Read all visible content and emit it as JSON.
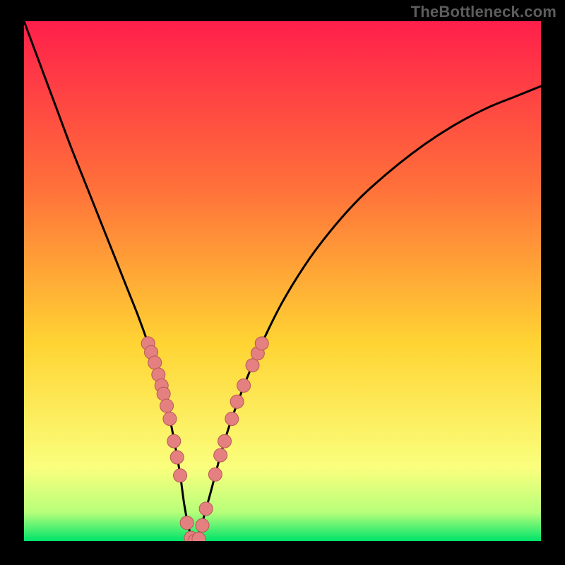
{
  "attribution": "TheBottleneck.com",
  "colors": {
    "gradient_top": "#ff1f4b",
    "gradient_mid_upper": "#ff703a",
    "gradient_mid": "#ffd433",
    "gradient_lower": "#faff7d",
    "gradient_lower2": "#b7ff7a",
    "gradient_bottom": "#00e46a",
    "curve": "#000000",
    "dot_fill": "#e48080",
    "dot_stroke": "#b85656",
    "frame": "#000000"
  },
  "chart_data": {
    "type": "line",
    "title": "",
    "xlabel": "",
    "ylabel": "",
    "xlim": [
      0,
      100
    ],
    "ylim": [
      0,
      100
    ],
    "x": [
      0,
      3,
      6,
      9,
      12,
      15,
      18,
      20,
      22,
      24,
      26,
      28,
      30,
      31,
      32,
      33,
      34,
      36,
      38,
      40,
      43,
      46,
      50,
      55,
      60,
      65,
      70,
      75,
      80,
      85,
      90,
      95,
      100
    ],
    "values": [
      100,
      92,
      84,
      76,
      68.5,
      61,
      53.5,
      48.5,
      43.5,
      38,
      32,
      24.5,
      14,
      7,
      2,
      0,
      2,
      9,
      16.5,
      23,
      31,
      38,
      46,
      54,
      60.5,
      66,
      70.5,
      74.5,
      78,
      81,
      83.5,
      85.5,
      87.5
    ],
    "minimum_x": 33,
    "dots": [
      {
        "x": 24.0,
        "y": 38.0
      },
      {
        "x": 24.6,
        "y": 36.3
      },
      {
        "x": 25.3,
        "y": 34.3
      },
      {
        "x": 26.0,
        "y": 32.0
      },
      {
        "x": 26.6,
        "y": 29.9
      },
      {
        "x": 27.0,
        "y": 28.3
      },
      {
        "x": 27.6,
        "y": 26.0
      },
      {
        "x": 28.2,
        "y": 23.5
      },
      {
        "x": 29.0,
        "y": 19.2
      },
      {
        "x": 29.6,
        "y": 16.1
      },
      {
        "x": 30.2,
        "y": 12.6
      },
      {
        "x": 31.5,
        "y": 3.5
      },
      {
        "x": 32.3,
        "y": 0.6
      },
      {
        "x": 33.0,
        "y": 0.0
      },
      {
        "x": 33.8,
        "y": 0.4
      },
      {
        "x": 34.5,
        "y": 3.0
      },
      {
        "x": 35.2,
        "y": 6.2
      },
      {
        "x": 37.0,
        "y": 12.8
      },
      {
        "x": 38.0,
        "y": 16.5
      },
      {
        "x": 38.8,
        "y": 19.2
      },
      {
        "x": 40.2,
        "y": 23.5
      },
      {
        "x": 41.2,
        "y": 26.8
      },
      {
        "x": 42.5,
        "y": 29.9
      },
      {
        "x": 44.2,
        "y": 33.8
      },
      {
        "x": 45.2,
        "y": 36.1
      },
      {
        "x": 46.0,
        "y": 38.0
      }
    ]
  }
}
